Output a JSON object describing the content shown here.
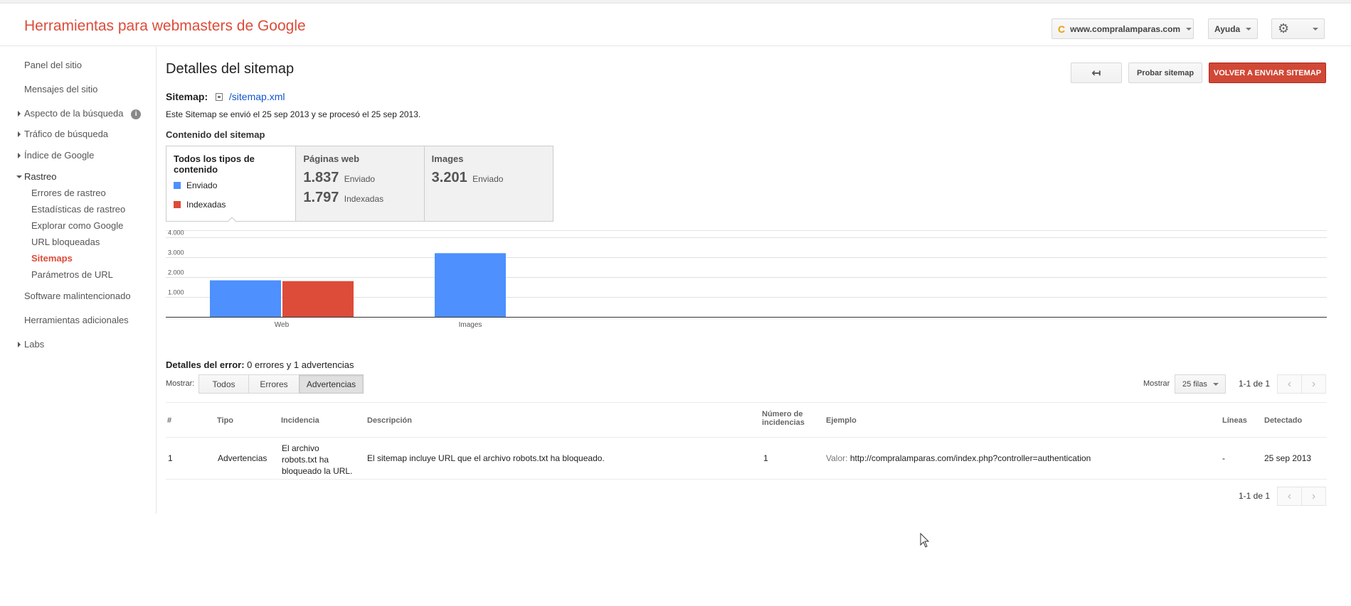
{
  "header": {
    "logo": "Herramientas para webmasters de Google",
    "site_icon": "C",
    "site": "www.compralamparas.com",
    "help": "Ayuda",
    "settings_icon": "gear-icon"
  },
  "sidebar": {
    "items": [
      {
        "label": "Panel del sitio"
      },
      {
        "label": "Mensajes del sitio"
      },
      {
        "label": "Aspecto de la búsqueda"
      },
      {
        "label": "Tráfico de búsqueda"
      },
      {
        "label": "Índice de Google"
      },
      {
        "label": "Rastreo"
      },
      {
        "label": "Software malintencionado"
      },
      {
        "label": "Herramientas adicionales"
      },
      {
        "label": "Labs"
      }
    ],
    "rastreo_sub": [
      {
        "label": "Errores de rastreo"
      },
      {
        "label": "Estadísticas de rastreo"
      },
      {
        "label": "Explorar como Google"
      },
      {
        "label": "URL bloqueadas"
      },
      {
        "label": "Sitemaps"
      },
      {
        "label": "Parámetros de URL"
      }
    ],
    "info_icon": "i"
  },
  "main": {
    "title": "Detalles del sitemap",
    "back_icon": "↤",
    "test_label": "Probar sitemap",
    "resend_label": "VOLVER A ENVIAR SITEMAP",
    "sitemap_label": "Sitemap:",
    "sitemap_file": "/sitemap.xml",
    "sitemap_info": "Este Sitemap se envió el 25 sep 2013 y se procesó el 25 sep 2013.",
    "content_title": "Contenido del sitemap",
    "tabs": {
      "all": {
        "title": "Todos los tipos de contenido",
        "legend_sent": "Enviado",
        "legend_indexed": "Indexadas"
      },
      "web": {
        "title": "Páginas web",
        "sent_value": "1.837",
        "sent_label": "Enviado",
        "indexed_value": "1.797",
        "indexed_label": "Indexadas"
      },
      "images": {
        "title": "Images",
        "sent_value": "3.201",
        "sent_label": "Enviado"
      }
    }
  },
  "colors": {
    "sent": "#4d90fe",
    "indexed": "#dd4b39",
    "accent": "#dd4b39",
    "link": "#1155cc"
  },
  "chart_data": {
    "type": "bar",
    "categories": [
      "Web",
      "Images"
    ],
    "series": [
      {
        "name": "Enviado",
        "values": [
          1837,
          3201
        ],
        "color": "#4d90fe"
      },
      {
        "name": "Indexadas",
        "values": [
          1797,
          null
        ],
        "color": "#dd4b39"
      }
    ],
    "yticks": [
      "4.000",
      "3.000",
      "2.000",
      "1.000"
    ],
    "ytick_values": [
      4000,
      3000,
      2000,
      1000
    ],
    "ylim": [
      0,
      4000
    ],
    "grid": true
  },
  "errors": {
    "title_bold": "Detalles del error:",
    "title_rest": " 0 errores y 1 advertencias",
    "show_label": "Mostrar:",
    "filters": [
      "Todos",
      "Errores",
      "Advertencias"
    ],
    "rows_label": "Mostrar",
    "rows_value": "25 filas",
    "pagination": "1-1 de 1",
    "prev_icon": "‹",
    "next_icon": "›",
    "columns": {
      "num": "#",
      "type": "Tipo",
      "issue": "Incidencia",
      "desc": "Descripción",
      "count_l1": "Número de",
      "count_l2": "incidencias",
      "example": "Ejemplo",
      "lines": "Líneas",
      "detected": "Detectado"
    },
    "row": {
      "num": "1",
      "type": "Advertencias",
      "issue_l1": "El archivo",
      "issue_l2": "robots.txt ha",
      "issue_l3": "bloqueado la URL.",
      "desc": "El sitemap incluye URL que el archivo robots.txt ha bloqueado.",
      "count": "1",
      "example_label": "Valor:",
      "example_value": "http://compralamparas.com/index.php?controller=authentication",
      "lines": "-",
      "detected": "25 sep 2013"
    }
  }
}
